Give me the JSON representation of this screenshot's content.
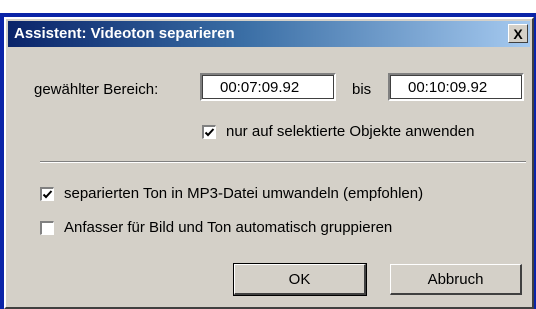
{
  "window": {
    "title": "Assistent: Videoton separieren",
    "close_glyph": "X"
  },
  "range": {
    "label": "gewählter Bereich:",
    "from": "00:07:09.92",
    "to_label": "bis",
    "to": "00:10:09.92"
  },
  "options": {
    "selected_only": {
      "label": "nur auf selektierte Objekte anwenden",
      "checked": true
    },
    "convert_mp3": {
      "label": "separierten Ton in MP3-Datei umwandeln (empfohlen)",
      "checked": true
    },
    "group_handles": {
      "label": "Anfasser für Bild und Ton automatisch gruppieren",
      "checked": false
    }
  },
  "buttons": {
    "ok": "OK",
    "cancel": "Abbruch"
  },
  "colors": {
    "title_gradient_start": "#0a246a",
    "title_gradient_end": "#a6caf0",
    "face": "#d4d0c8",
    "desktop": "#0a24a8"
  }
}
